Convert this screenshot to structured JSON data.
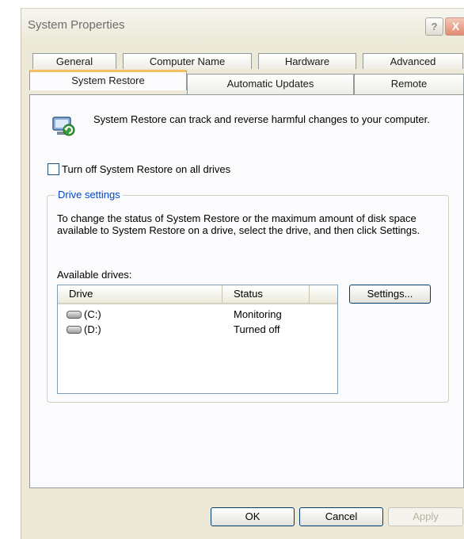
{
  "window": {
    "title": "System Properties",
    "help_label": "?",
    "close_label": "X"
  },
  "tabs_row1": [
    {
      "label": "General"
    },
    {
      "label": "Computer Name"
    },
    {
      "label": "Hardware"
    },
    {
      "label": "Advanced"
    }
  ],
  "tabs_row2": [
    {
      "label": "System Restore",
      "active": true
    },
    {
      "label": "Automatic Updates"
    },
    {
      "label": "Remote"
    }
  ],
  "panel": {
    "intro": "System Restore can track and reverse harmful changes to your computer.",
    "turn_off_label": "Turn off System Restore on all drives",
    "turn_off_checked": false
  },
  "drive_settings": {
    "title": "Drive settings",
    "description": "To change the status of System Restore or the maximum amount of disk space available to System Restore on a drive, select the drive, and then click Settings.",
    "available_label": "Available drives:",
    "columns": [
      "Drive",
      "Status"
    ],
    "drives": [
      {
        "name": "(C:)",
        "status": "Monitoring"
      },
      {
        "name": "(D:)",
        "status": "Turned off"
      }
    ],
    "settings_button": "Settings..."
  },
  "buttons": {
    "ok": "OK",
    "cancel": "Cancel",
    "apply": "Apply",
    "apply_enabled": false
  }
}
